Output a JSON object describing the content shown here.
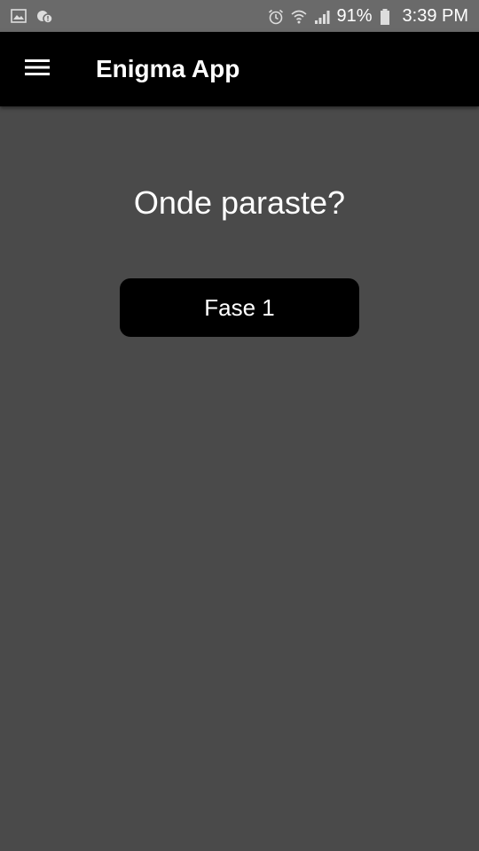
{
  "status_bar": {
    "left_icons": [
      "gallery-icon",
      "notification-icon"
    ],
    "right_icons": [
      "alarm-icon",
      "wifi-icon",
      "signal-icon"
    ],
    "battery_percent": "91%",
    "battery_icon": "battery-icon",
    "time": "3:39 PM"
  },
  "app_bar": {
    "menu_icon": "hamburger-menu-icon",
    "title": "Enigma App",
    "background": "#000000"
  },
  "main": {
    "question": "Onde paraste?",
    "phase_button_label": "Fase 1"
  },
  "colors": {
    "background": "#4a4a4a",
    "status_bar": "#6a6a6a",
    "button": "#000000",
    "text": "#ffffff"
  }
}
